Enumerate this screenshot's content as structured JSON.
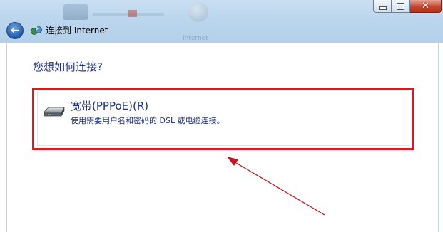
{
  "window": {
    "title": "连接到 Internet",
    "ghost_label_right": "Internet"
  },
  "content": {
    "question": "您想如何连接?",
    "option": {
      "title": "宽带(PPPoE)(R)",
      "description": "使用需要用户名和密码的 DSL 或电缆连接。",
      "icon": "modem-icon"
    }
  },
  "annotation": {
    "highlight_color": "#e8131b",
    "arrow_color": "#c0171c"
  },
  "icons": {
    "back": "back-arrow-icon",
    "network": "network-icon",
    "minimize": "minimize-icon",
    "maximize": "maximize-icon",
    "close": "close-icon"
  }
}
